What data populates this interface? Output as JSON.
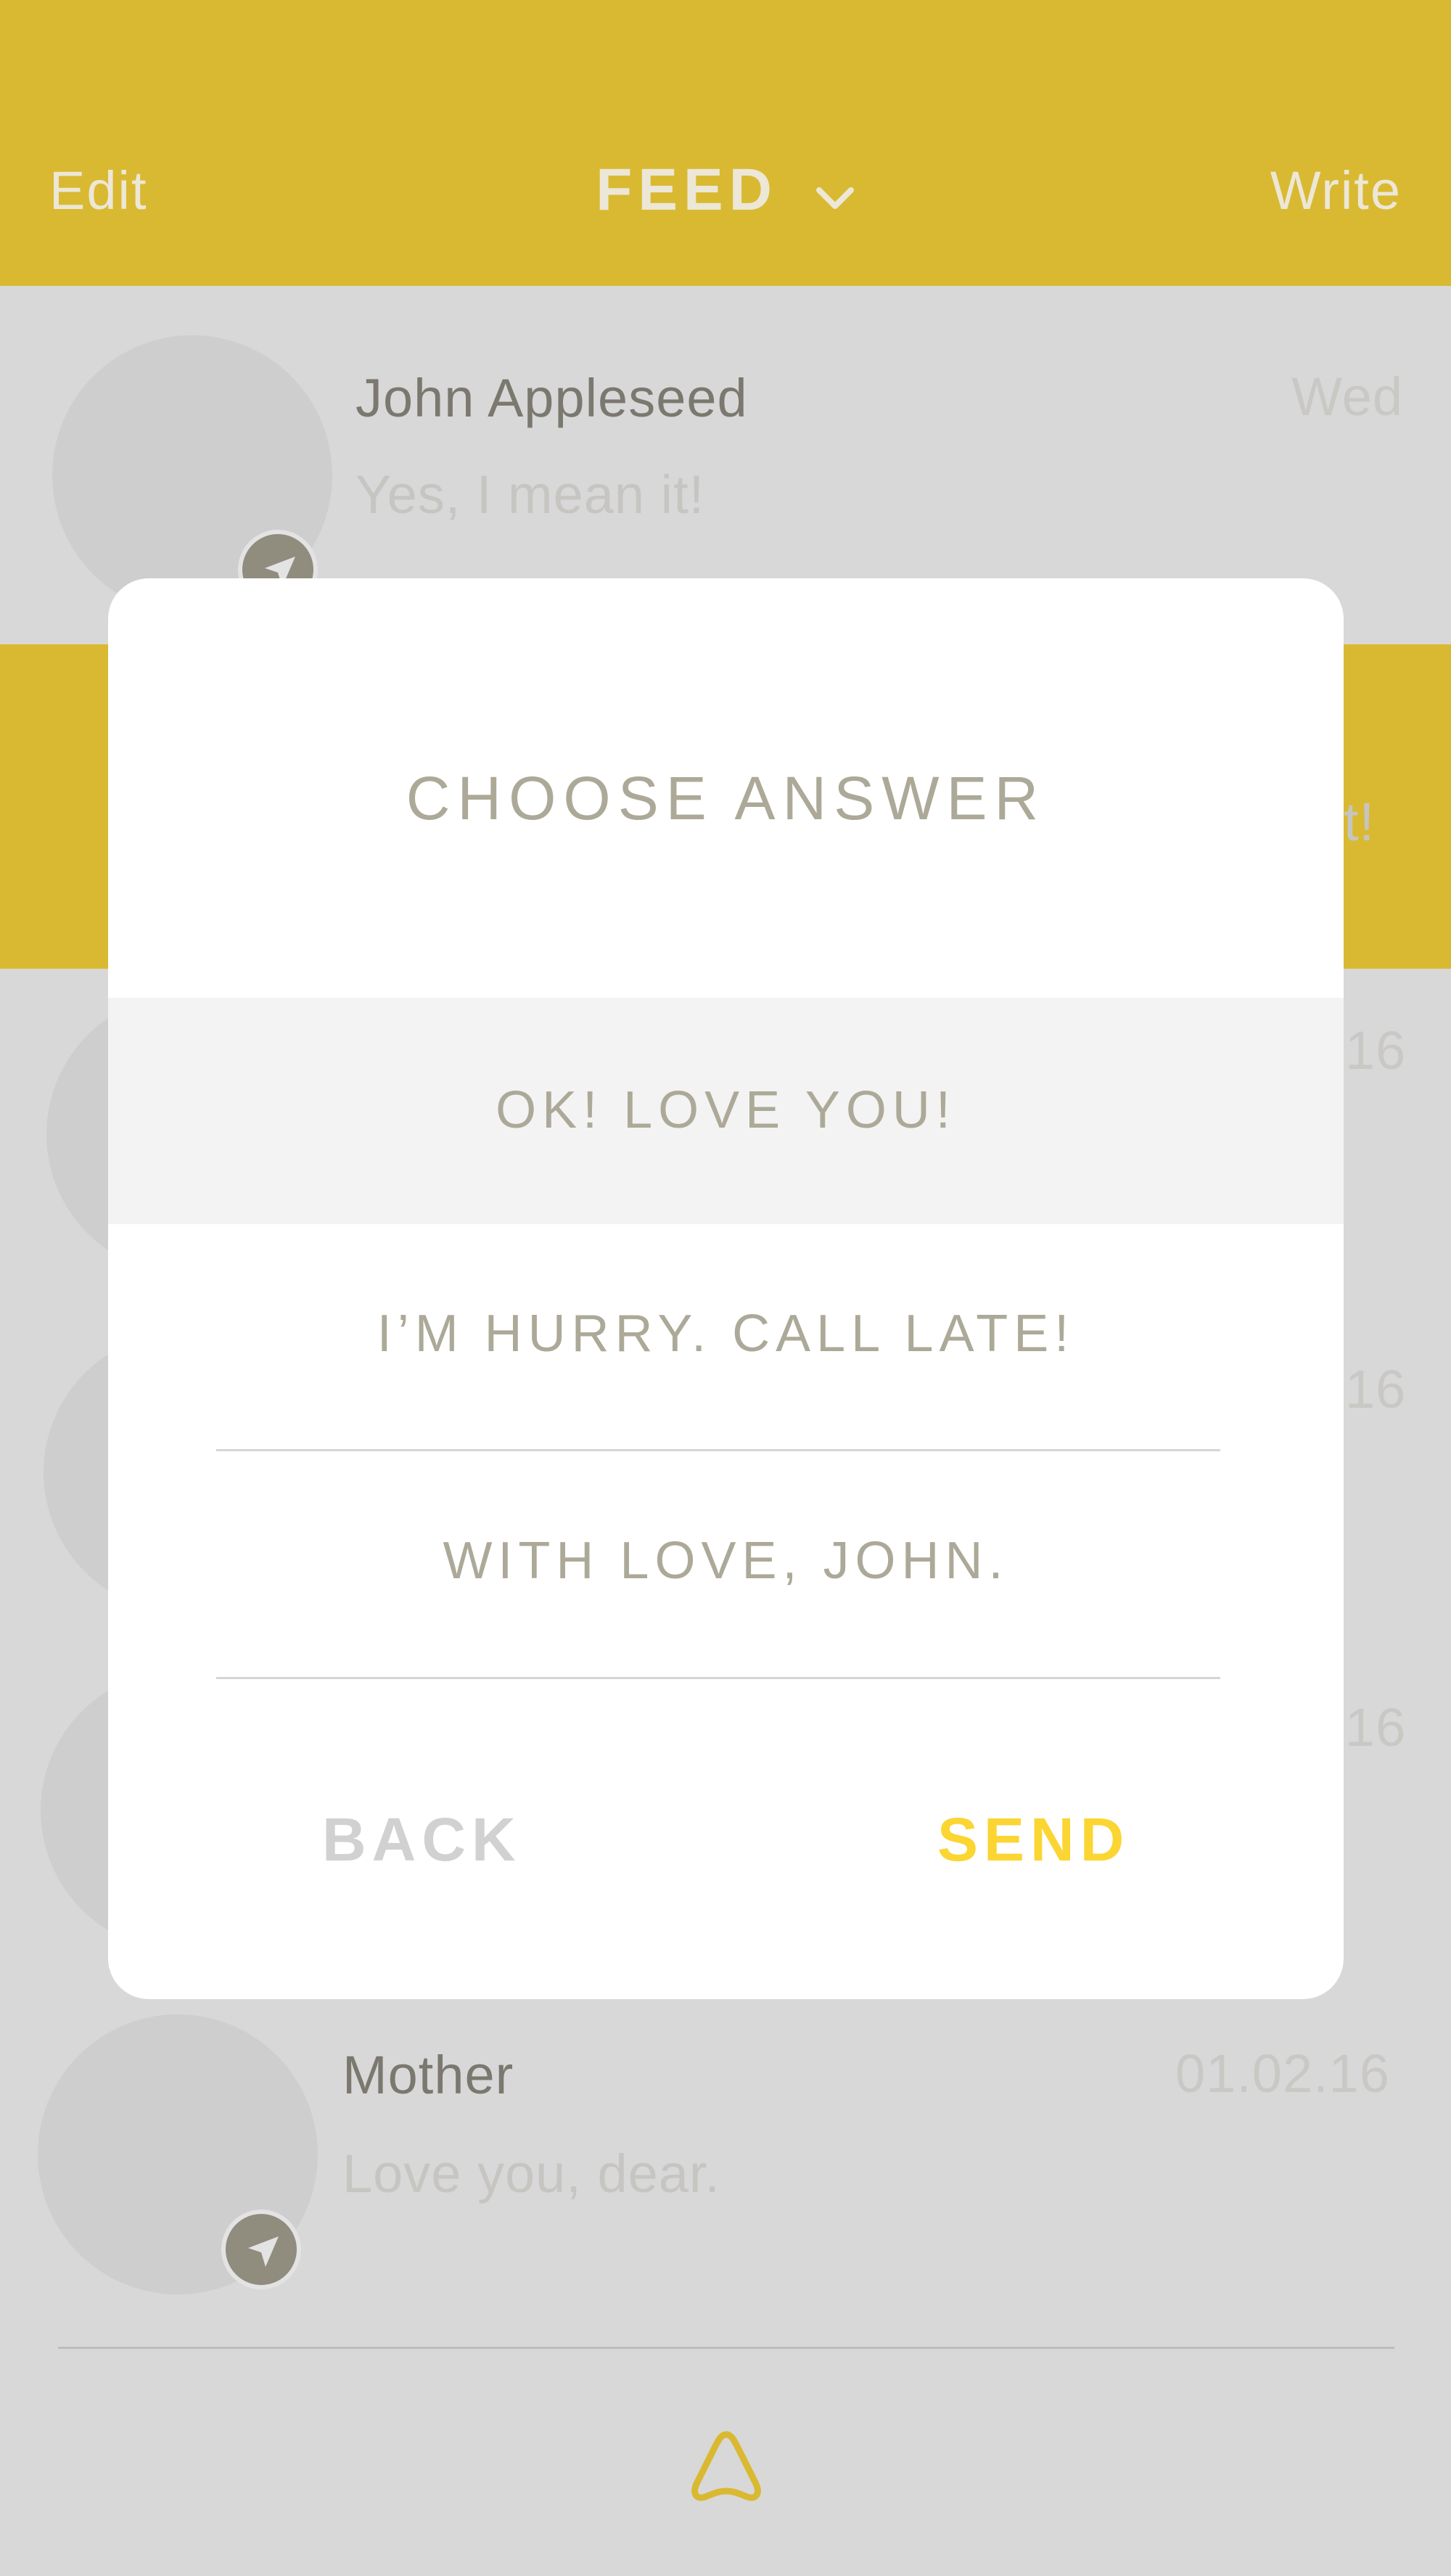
{
  "header": {
    "edit_label": "Edit",
    "title": "FEED",
    "write_label": "Write",
    "bg_color": "#d9b931"
  },
  "feed": [
    {
      "name": "John Appleseed",
      "message": "Yes, I mean it!",
      "date": "Wed"
    },
    {
      "partial_message": "t!"
    },
    {
      "date_partial": "16"
    },
    {
      "date_partial": "16"
    },
    {
      "date_partial": "16"
    },
    {
      "name": "Mother",
      "message": "Love you, dear.",
      "date": "01.02.16"
    }
  ],
  "dialog": {
    "title": "CHOOSE ANSWER",
    "options": [
      {
        "label": "OK! LOVE YOU!",
        "selected": true
      },
      {
        "label": "I’M HURRY. CALL LATE!",
        "selected": false
      },
      {
        "label": "WITH LOVE, JOHN.",
        "selected": false
      }
    ],
    "back_label": "BACK",
    "send_label": "SEND",
    "send_color": "#fbd532"
  },
  "tabbar": {
    "icon": "triangle-logo-icon"
  }
}
